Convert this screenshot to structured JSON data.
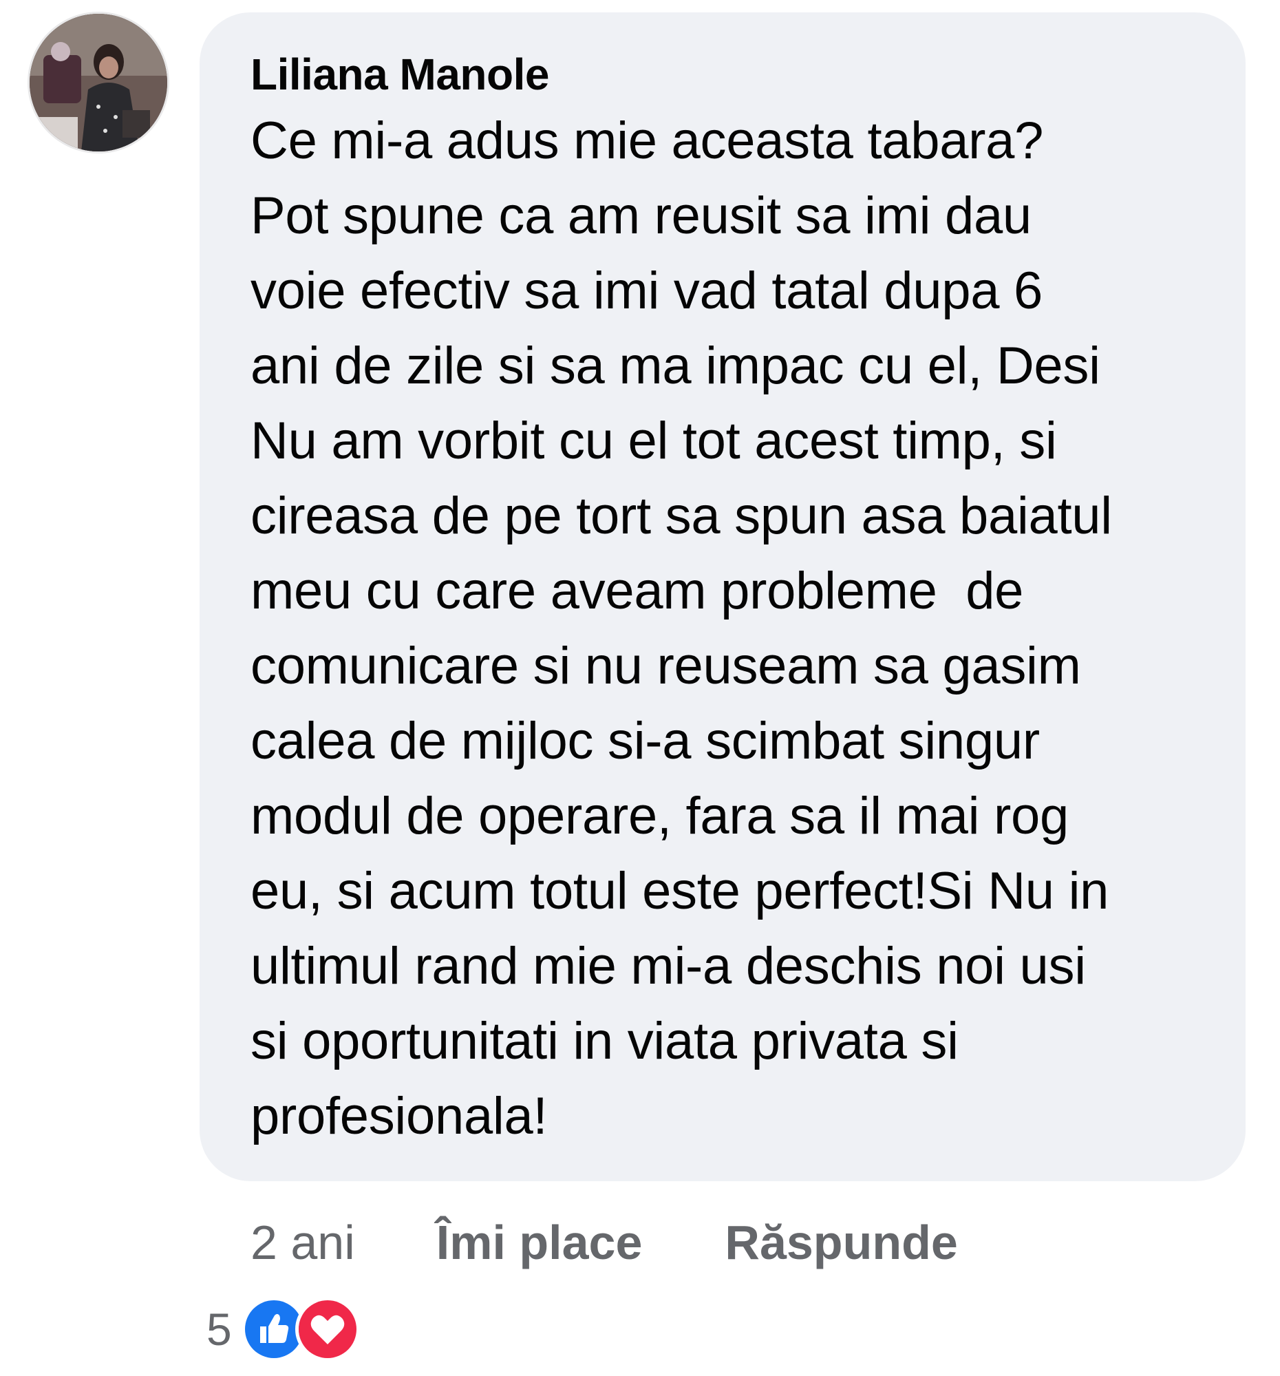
{
  "comment": {
    "author": "Liliana Manole",
    "text_lines": [
      "Ce mi-a adus mie aceasta tabara?",
      "Pot spune ca am reusit sa imi dau",
      "voie efectiv sa imi vad tatal dupa 6",
      "ani de zile si sa ma impac cu el, Desi",
      "Nu am vorbit cu el tot acest timp, si",
      "cireasa de pe tort sa spun asa baiatul",
      "meu cu care aveam probleme  de",
      "comunicare si nu reuseam sa gasim",
      "calea de mijloc si-a scimbat singur",
      "modul de operare, fara sa il mai rog",
      "eu, si acum totul este perfect!Si Nu in",
      "ultimul rand mie mi-a deschis noi usi",
      "si oportunitati in viata privata si",
      "profesionala!"
    ]
  },
  "actions": {
    "time": "2 ani",
    "like_label": "Îmi place",
    "reply_label": "Răspunde"
  },
  "reactions": {
    "count": "5",
    "icons": [
      "like-icon",
      "love-icon"
    ]
  },
  "colors": {
    "bubble_bg": "#eff1f5",
    "action_text": "#65676b",
    "like_blue": "#1877f2",
    "love_red": "#f02849"
  }
}
